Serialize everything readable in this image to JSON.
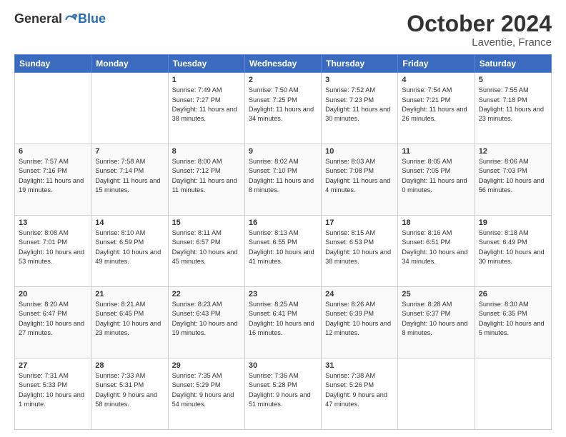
{
  "header": {
    "logo_general": "General",
    "logo_blue": "Blue",
    "month": "October 2024",
    "location": "Laventie, France"
  },
  "weekdays": [
    "Sunday",
    "Monday",
    "Tuesday",
    "Wednesday",
    "Thursday",
    "Friday",
    "Saturday"
  ],
  "weeks": [
    [
      {
        "day": "",
        "info": ""
      },
      {
        "day": "",
        "info": ""
      },
      {
        "day": "1",
        "info": "Sunrise: 7:49 AM\nSunset: 7:27 PM\nDaylight: 11 hours and 38 minutes."
      },
      {
        "day": "2",
        "info": "Sunrise: 7:50 AM\nSunset: 7:25 PM\nDaylight: 11 hours and 34 minutes."
      },
      {
        "day": "3",
        "info": "Sunrise: 7:52 AM\nSunset: 7:23 PM\nDaylight: 11 hours and 30 minutes."
      },
      {
        "day": "4",
        "info": "Sunrise: 7:54 AM\nSunset: 7:21 PM\nDaylight: 11 hours and 26 minutes."
      },
      {
        "day": "5",
        "info": "Sunrise: 7:55 AM\nSunset: 7:18 PM\nDaylight: 11 hours and 23 minutes."
      }
    ],
    [
      {
        "day": "6",
        "info": "Sunrise: 7:57 AM\nSunset: 7:16 PM\nDaylight: 11 hours and 19 minutes."
      },
      {
        "day": "7",
        "info": "Sunrise: 7:58 AM\nSunset: 7:14 PM\nDaylight: 11 hours and 15 minutes."
      },
      {
        "day": "8",
        "info": "Sunrise: 8:00 AM\nSunset: 7:12 PM\nDaylight: 11 hours and 11 minutes."
      },
      {
        "day": "9",
        "info": "Sunrise: 8:02 AM\nSunset: 7:10 PM\nDaylight: 11 hours and 8 minutes."
      },
      {
        "day": "10",
        "info": "Sunrise: 8:03 AM\nSunset: 7:08 PM\nDaylight: 11 hours and 4 minutes."
      },
      {
        "day": "11",
        "info": "Sunrise: 8:05 AM\nSunset: 7:05 PM\nDaylight: 11 hours and 0 minutes."
      },
      {
        "day": "12",
        "info": "Sunrise: 8:06 AM\nSunset: 7:03 PM\nDaylight: 10 hours and 56 minutes."
      }
    ],
    [
      {
        "day": "13",
        "info": "Sunrise: 8:08 AM\nSunset: 7:01 PM\nDaylight: 10 hours and 53 minutes."
      },
      {
        "day": "14",
        "info": "Sunrise: 8:10 AM\nSunset: 6:59 PM\nDaylight: 10 hours and 49 minutes."
      },
      {
        "day": "15",
        "info": "Sunrise: 8:11 AM\nSunset: 6:57 PM\nDaylight: 10 hours and 45 minutes."
      },
      {
        "day": "16",
        "info": "Sunrise: 8:13 AM\nSunset: 6:55 PM\nDaylight: 10 hours and 41 minutes."
      },
      {
        "day": "17",
        "info": "Sunrise: 8:15 AM\nSunset: 6:53 PM\nDaylight: 10 hours and 38 minutes."
      },
      {
        "day": "18",
        "info": "Sunrise: 8:16 AM\nSunset: 6:51 PM\nDaylight: 10 hours and 34 minutes."
      },
      {
        "day": "19",
        "info": "Sunrise: 8:18 AM\nSunset: 6:49 PM\nDaylight: 10 hours and 30 minutes."
      }
    ],
    [
      {
        "day": "20",
        "info": "Sunrise: 8:20 AM\nSunset: 6:47 PM\nDaylight: 10 hours and 27 minutes."
      },
      {
        "day": "21",
        "info": "Sunrise: 8:21 AM\nSunset: 6:45 PM\nDaylight: 10 hours and 23 minutes."
      },
      {
        "day": "22",
        "info": "Sunrise: 8:23 AM\nSunset: 6:43 PM\nDaylight: 10 hours and 19 minutes."
      },
      {
        "day": "23",
        "info": "Sunrise: 8:25 AM\nSunset: 6:41 PM\nDaylight: 10 hours and 16 minutes."
      },
      {
        "day": "24",
        "info": "Sunrise: 8:26 AM\nSunset: 6:39 PM\nDaylight: 10 hours and 12 minutes."
      },
      {
        "day": "25",
        "info": "Sunrise: 8:28 AM\nSunset: 6:37 PM\nDaylight: 10 hours and 8 minutes."
      },
      {
        "day": "26",
        "info": "Sunrise: 8:30 AM\nSunset: 6:35 PM\nDaylight: 10 hours and 5 minutes."
      }
    ],
    [
      {
        "day": "27",
        "info": "Sunrise: 7:31 AM\nSunset: 5:33 PM\nDaylight: 10 hours and 1 minute."
      },
      {
        "day": "28",
        "info": "Sunrise: 7:33 AM\nSunset: 5:31 PM\nDaylight: 9 hours and 58 minutes."
      },
      {
        "day": "29",
        "info": "Sunrise: 7:35 AM\nSunset: 5:29 PM\nDaylight: 9 hours and 54 minutes."
      },
      {
        "day": "30",
        "info": "Sunrise: 7:36 AM\nSunset: 5:28 PM\nDaylight: 9 hours and 51 minutes."
      },
      {
        "day": "31",
        "info": "Sunrise: 7:38 AM\nSunset: 5:26 PM\nDaylight: 9 hours and 47 minutes."
      },
      {
        "day": "",
        "info": ""
      },
      {
        "day": "",
        "info": ""
      }
    ]
  ]
}
